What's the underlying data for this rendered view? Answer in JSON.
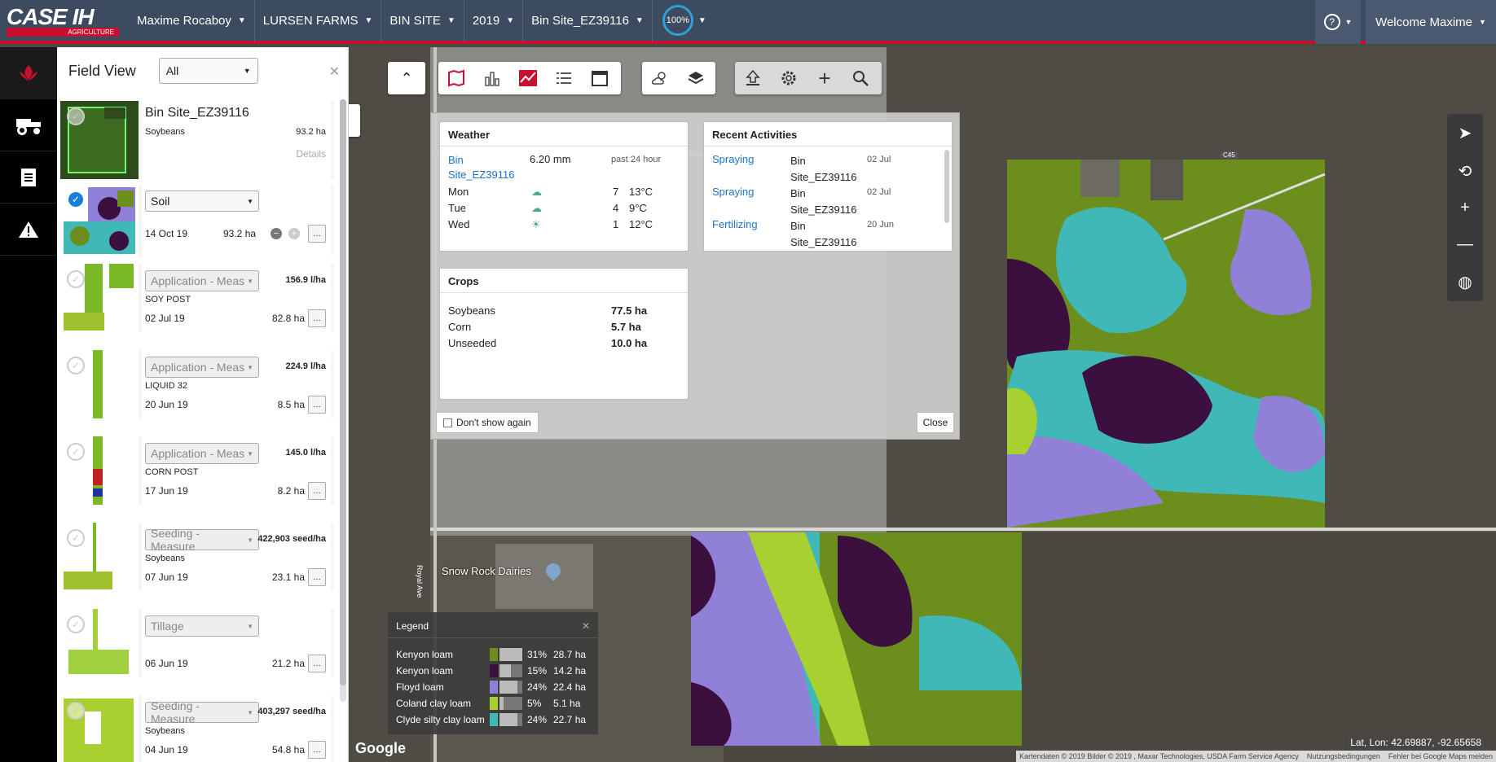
{
  "brand": {
    "line1": "CASE IH",
    "line2": "AGRICULTURE"
  },
  "nav": {
    "items": [
      "Maxime Rocaboy",
      "LURSEN FARMS",
      "BIN SITE",
      "2019",
      "Bin Site_EZ39116"
    ],
    "zoom": "100%",
    "help": "?",
    "welcome": "Welcome Maxime"
  },
  "field_panel": {
    "title": "Field View",
    "filter": "All",
    "field": {
      "name": "Bin Site_EZ39116",
      "crop": "Soybeans",
      "area": "93.2 ha",
      "details": "Details"
    },
    "soil": {
      "layer": "Soil",
      "date": "14 Oct 19",
      "area": "93.2 ha"
    },
    "cards": [
      {
        "layer": "Application - Meas",
        "rate": "156.9 l/ha",
        "product": "SOY POST",
        "date": "02 Jul 19",
        "area": "82.8 ha"
      },
      {
        "layer": "Application - Meas",
        "rate": "224.9 l/ha",
        "product": "LIQUID 32",
        "date": "20 Jun 19",
        "area": "8.5 ha"
      },
      {
        "layer": "Application - Meas",
        "rate": "145.0 l/ha",
        "product": "CORN POST",
        "date": "17 Jun 19",
        "area": "8.2 ha"
      },
      {
        "layer": "Seeding - Measure",
        "rate": "422,903 seed/ha",
        "product": "Soybeans",
        "date": "07 Jun 19",
        "area": "23.1 ha"
      },
      {
        "layer": "Tillage",
        "rate": "",
        "product": "",
        "date": "06 Jun 19",
        "area": "21.2 ha"
      },
      {
        "layer": "Seeding - Measure",
        "rate": "403,297 seed/ha",
        "product": "Soybeans",
        "date": "04 Jun 19",
        "area": "54.8 ha"
      }
    ]
  },
  "dialog": {
    "weather": {
      "title": "Weather",
      "site": "Bin Site_EZ39116",
      "rain": "6.20 mm",
      "period": "past 24 hour",
      "days": [
        {
          "day": "Mon",
          "num": "7",
          "temp": "13°C"
        },
        {
          "day": "Tue",
          "num": "4",
          "temp": "9°C"
        },
        {
          "day": "Wed",
          "num": "1",
          "temp": "12°C"
        }
      ]
    },
    "activities": {
      "title": "Recent Activities",
      "items": [
        {
          "type": "Spraying",
          "site": "Bin Site_EZ39116",
          "date": "02 Jul"
        },
        {
          "type": "Spraying",
          "site": "Bin Site_EZ39116",
          "date": "02 Jul"
        },
        {
          "type": "Fertilizing",
          "site": "Bin Site_EZ39116",
          "date": "20 Jun"
        }
      ]
    },
    "crops": {
      "title": "Crops",
      "items": [
        {
          "name": "Soybeans",
          "area": "77.5 ha"
        },
        {
          "name": "Corn",
          "area": "5.7 ha"
        },
        {
          "name": "Unseeded",
          "area": "10.0 ha"
        }
      ]
    },
    "dont_show": "Don't show again",
    "close": "Close"
  },
  "legend": {
    "title": "Legend",
    "rows": [
      {
        "name": "Kenyon loam",
        "color": "#6b8e1c",
        "pct": "31%",
        "area": "28.7 ha",
        "fraction": 0.31
      },
      {
        "name": "Kenyon loam",
        "color": "#3b0f3e",
        "pct": "15%",
        "area": "14.2 ha",
        "fraction": 0.15
      },
      {
        "name": "Floyd loam",
        "color": "#9080d8",
        "pct": "24%",
        "area": "22.4 ha",
        "fraction": 0.24
      },
      {
        "name": "Coland clay loam",
        "color": "#a8d030",
        "pct": "5%",
        "area": "5.1 ha",
        "fraction": 0.05
      },
      {
        "name": "Clyde silty clay loam",
        "color": "#40b8b8",
        "pct": "24%",
        "area": "22.7 ha",
        "fraction": 0.24
      }
    ]
  },
  "map": {
    "labels": {
      "dairy": "Snow Rock Dairies",
      "road": "Royal Ave",
      "road2": "C45"
    },
    "latlon": "Lat, Lon: 42.69887, -92.65658",
    "attribution": [
      "Kartendaten © 2019 Bilder © 2019 , Maxar Technologies, USDA Farm Service Agency",
      "Nutzungsbedingungen",
      "Fehler bei Google Maps melden"
    ],
    "google": "Google"
  },
  "colors": {
    "topbar": "#3d4b60",
    "accent": "#c8102e",
    "link": "#1a73c8"
  }
}
